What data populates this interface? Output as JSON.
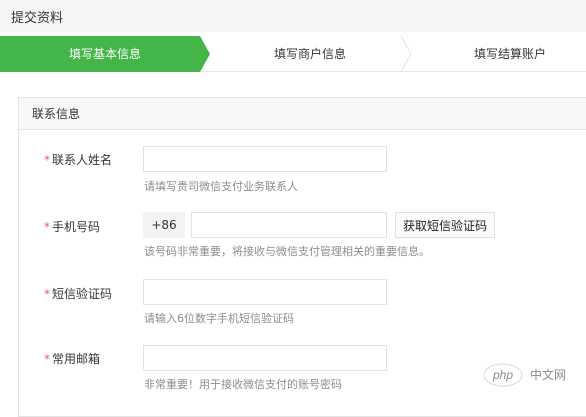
{
  "header": {
    "title": "提交资料"
  },
  "steps": [
    {
      "label": "填写基本信息",
      "active": true
    },
    {
      "label": "填写商户信息",
      "active": false
    },
    {
      "label": "填写结算账户",
      "active": false
    }
  ],
  "colors": {
    "accent": "#44b549",
    "required": "#e15f63",
    "hint": "#8d8d8d"
  },
  "section": {
    "title": "联系信息"
  },
  "fields": {
    "contact_name": {
      "required_mark": "*",
      "label": "联系人姓名",
      "value": "",
      "hint": "请填写贵司微信支付业务联系人"
    },
    "phone": {
      "required_mark": "*",
      "label": "手机号码",
      "prefix": "+86",
      "value": "",
      "button": "获取短信验证码",
      "hint": "该号码非常重要，将接收与微信支付管理相关的重要信息。"
    },
    "sms_code": {
      "required_mark": "*",
      "label": "短信验证码",
      "value": "",
      "hint": "请输入6位数字手机短信验证码"
    },
    "email": {
      "required_mark": "*",
      "label": "常用邮箱",
      "value": "",
      "hint": "非常重要！用于接收微信支付的账号密码"
    }
  },
  "watermark": {
    "logo_text": "php",
    "site_text": "中文网"
  }
}
